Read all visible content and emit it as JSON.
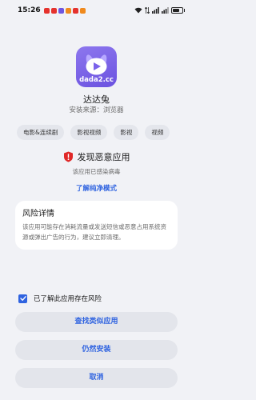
{
  "status_bar": {
    "time": "15:26",
    "notification_icons": [
      "app-notif-red",
      "app-notif-red",
      "app-notif-purple",
      "app-notif-orange",
      "app-notif-red",
      "app-notif-orange"
    ],
    "battery_level": 0.7
  },
  "app": {
    "icon_label": "dada2.cc",
    "name": "达达兔",
    "install_source": "安装来源：浏览器"
  },
  "tags": [
    "电影&连续剧",
    "影视视频",
    "影视",
    "视频"
  ],
  "warning": {
    "title": "发现恶意应用",
    "subtitle": "该应用已感染病毒",
    "link": "了解纯净模式"
  },
  "risk": {
    "title": "风险详情",
    "body": "该应用可能存在消耗流量或发送短信或恶意占用系统资源或弹出广告的行为，建议立即清理。"
  },
  "acknowledge": {
    "checked": true,
    "label": "已了解此应用存在风险"
  },
  "buttons": {
    "find_similar": "查找类似应用",
    "install_anyway": "仍然安装",
    "cancel": "取消"
  },
  "colors": {
    "accent": "#2f63e0",
    "danger": "#e02828",
    "icon_purple": "#7a62ea"
  }
}
